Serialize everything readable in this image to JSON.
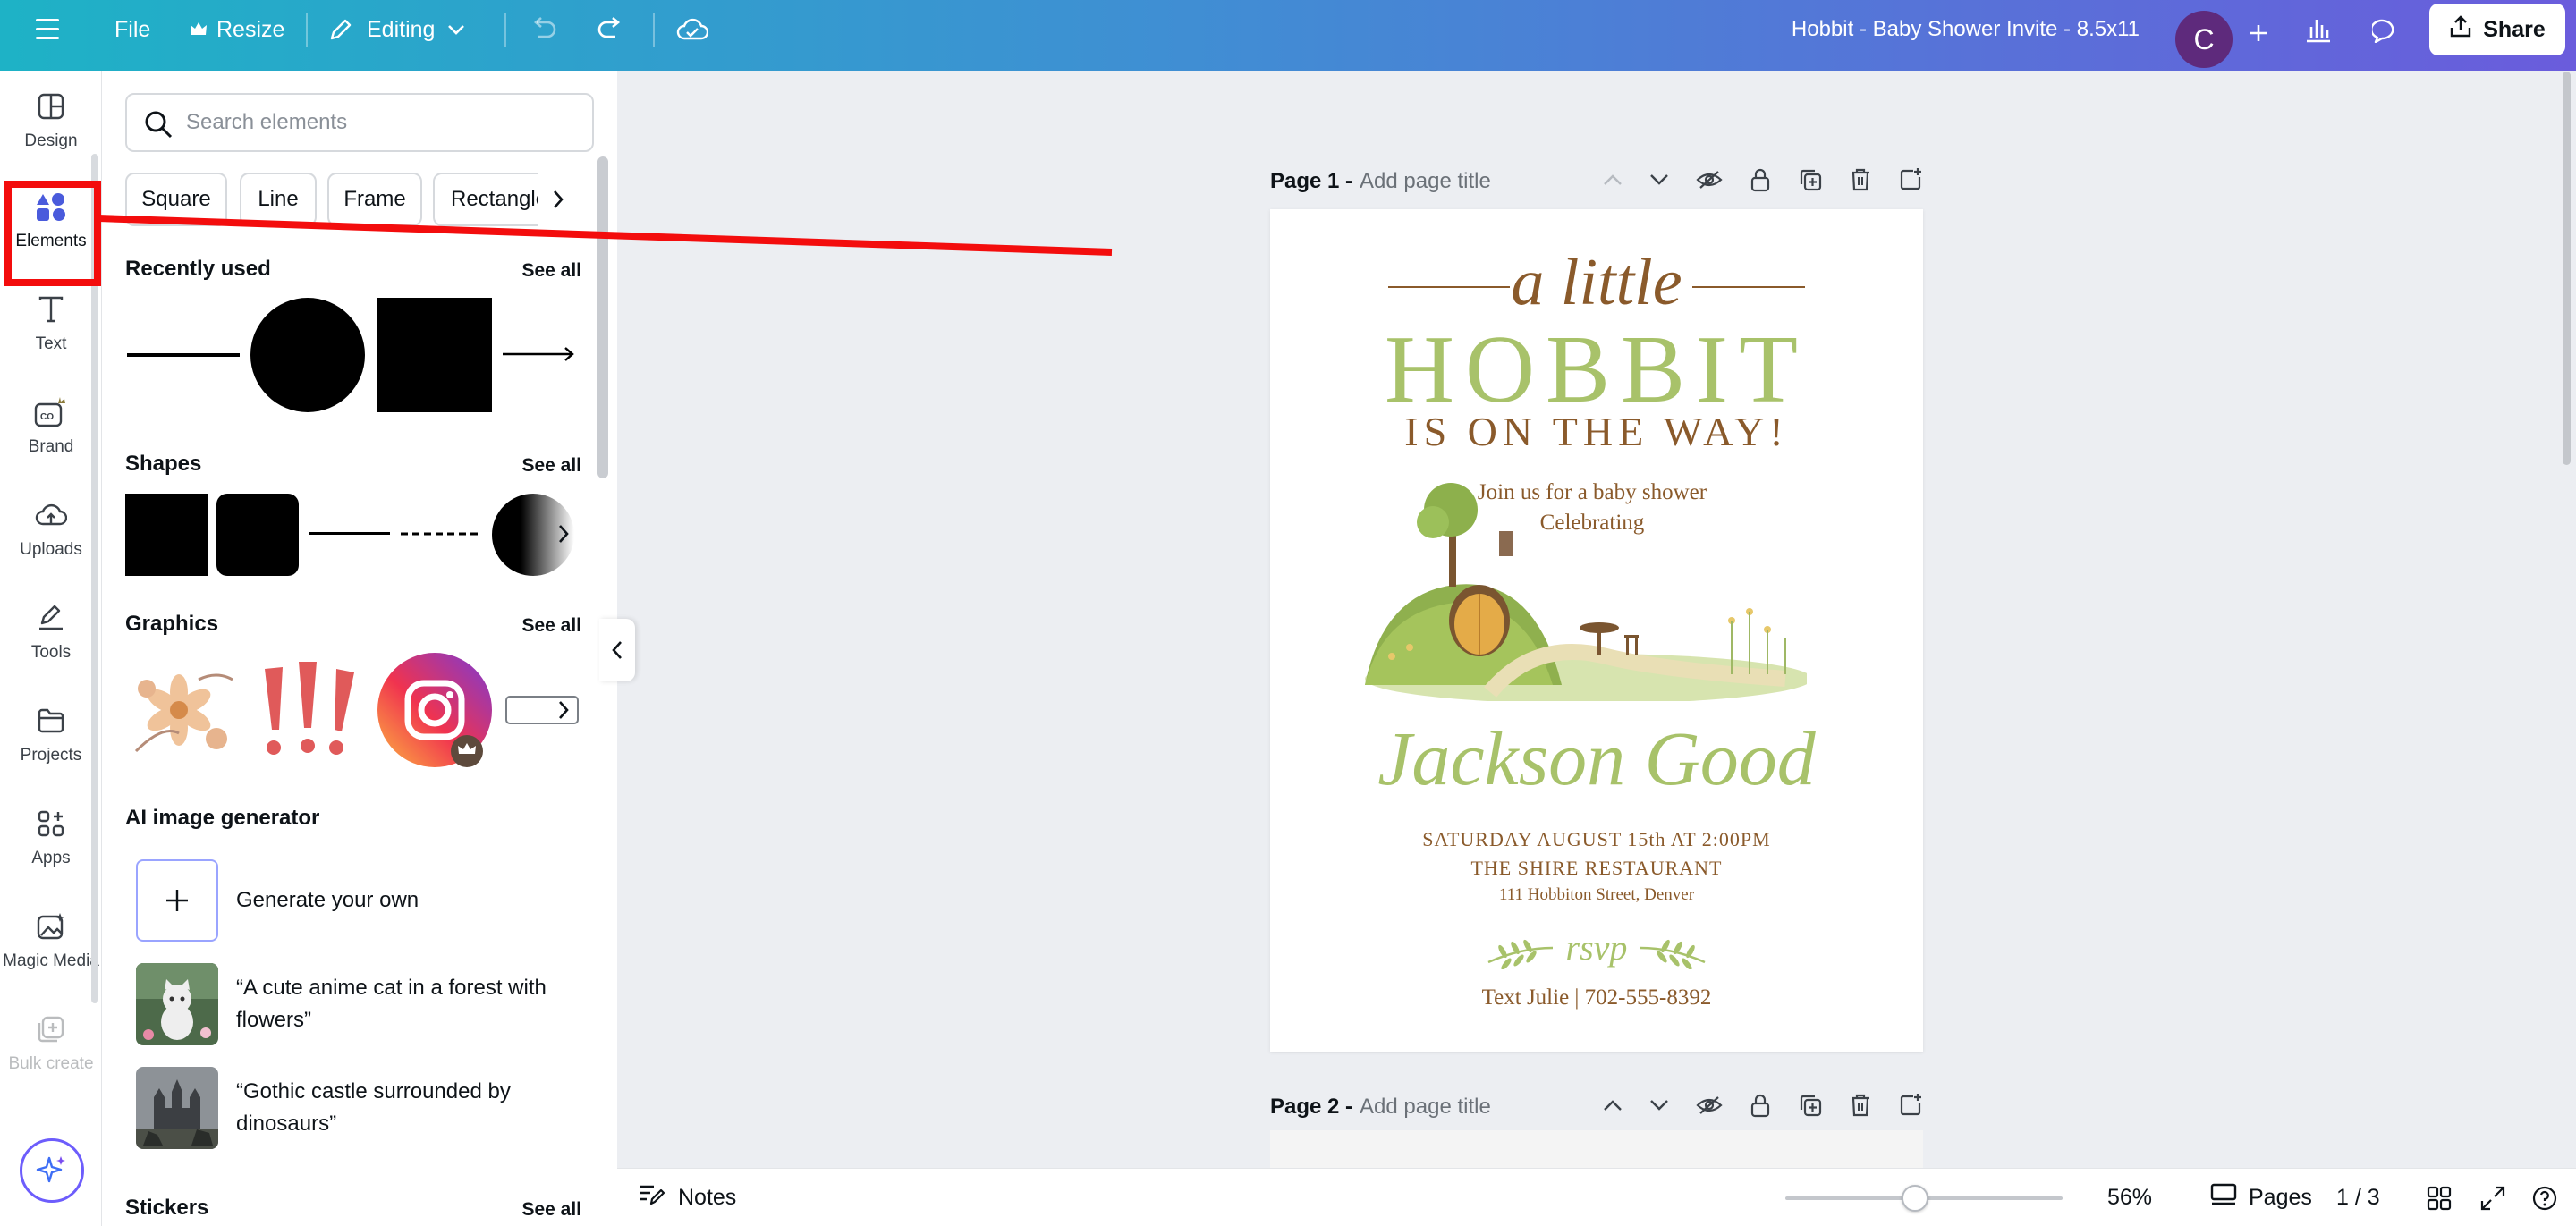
{
  "topbar": {
    "file_label": "File",
    "resize_label": "Resize",
    "editing_label": "Editing",
    "doc_title": "Hobbit - Baby Shower Invite - 8.5x11",
    "avatar_initial": "C",
    "share_label": "Share"
  },
  "rail": {
    "items": [
      {
        "label": "Design",
        "icon": "design-icon"
      },
      {
        "label": "Elements",
        "icon": "elements-icon"
      },
      {
        "label": "Text",
        "icon": "text-icon"
      },
      {
        "label": "Brand",
        "icon": "brand-icon"
      },
      {
        "label": "Uploads",
        "icon": "uploads-icon"
      },
      {
        "label": "Tools",
        "icon": "tools-icon"
      },
      {
        "label": "Projects",
        "icon": "projects-icon"
      },
      {
        "label": "Apps",
        "icon": "apps-icon"
      },
      {
        "label": "Magic Media",
        "icon": "magic-media-icon"
      },
      {
        "label": "Bulk create",
        "icon": "bulk-create-icon"
      }
    ]
  },
  "panel": {
    "search_placeholder": "Search elements",
    "chips": [
      "Square",
      "Line",
      "Frame",
      "Rectangle"
    ],
    "recently_used": "Recently used",
    "shapes": "Shapes",
    "graphics": "Graphics",
    "ai_generator": "AI image generator",
    "generate_own": "Generate your own",
    "ai_prompt_1": "“A cute anime cat in a forest with flowers”",
    "ai_prompt_2": "“Gothic castle surrounded by dinosaurs”",
    "stickers": "Stickers",
    "see_all": "See all"
  },
  "canvas": {
    "page1_name": "Page 1 -",
    "page2_name": "Page 2 -",
    "page_title_placeholder": "Add page title",
    "invite": {
      "a_little": "a little",
      "hobbit": "HOBBIT",
      "on_the_way": "IS ON THE WAY!",
      "join_line": "Join us for a baby shower",
      "celebrating": "Celebrating",
      "name": "Jackson Good",
      "date": "SATURDAY AUGUST 15th AT 2:00PM",
      "venue": "THE SHIRE RESTAURANT",
      "address": "111 Hobbiton Street, Denver",
      "rsvp": "rsvp",
      "contact": "Text Julie | 702-555-8392"
    }
  },
  "bottombar": {
    "notes_label": "Notes",
    "zoom": "56%",
    "pages_label": "Pages",
    "page_count": "1 / 3"
  },
  "colors": {
    "brown": "#8a5a2b",
    "green": "#a8c26a",
    "highlight": "#f30d0d"
  }
}
